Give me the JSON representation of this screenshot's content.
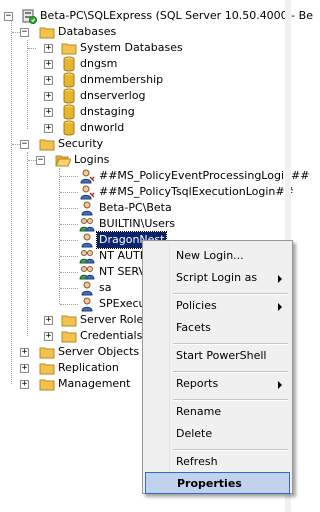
{
  "tree": {
    "server": "Beta-PC\\SQLExpress (SQL Server 10.50.4000 - Be",
    "databases": "Databases",
    "system_databases": "System Databases",
    "db_items": [
      "dngsm",
      "dnmembership",
      "dnserverlog",
      "dnstaging",
      "dnworld"
    ],
    "security": "Security",
    "logins": "Logins",
    "login_items": [
      "##MS_PolicyEventProcessingLogin##",
      "##MS_PolicyTsqlExecutionLogin##",
      "Beta-PC\\Beta",
      "BUILTIN\\Users",
      "DragonNest",
      "NT AUTH",
      "NT SERV",
      "sa",
      "SPExecu"
    ],
    "server_roles": "Server Roles",
    "credentials": "Credentials",
    "server_objects": "Server Objects",
    "replication": "Replication",
    "management": "Management"
  },
  "expand_glyphs": {
    "collapsed": "+",
    "expanded": "−"
  },
  "context_menu": {
    "new_login": "New Login...",
    "script_login_as": "Script Login as",
    "policies": "Policies",
    "facets": "Facets",
    "start_powershell": "Start PowerShell",
    "reports": "Reports",
    "rename": "Rename",
    "delete": "Delete",
    "refresh": "Refresh",
    "properties": "Properties"
  },
  "colors": {
    "selection": "#0a246a",
    "menu_highlight": "#c1d2ee",
    "folder": "#f2c24e",
    "database": "#e8b52c"
  }
}
